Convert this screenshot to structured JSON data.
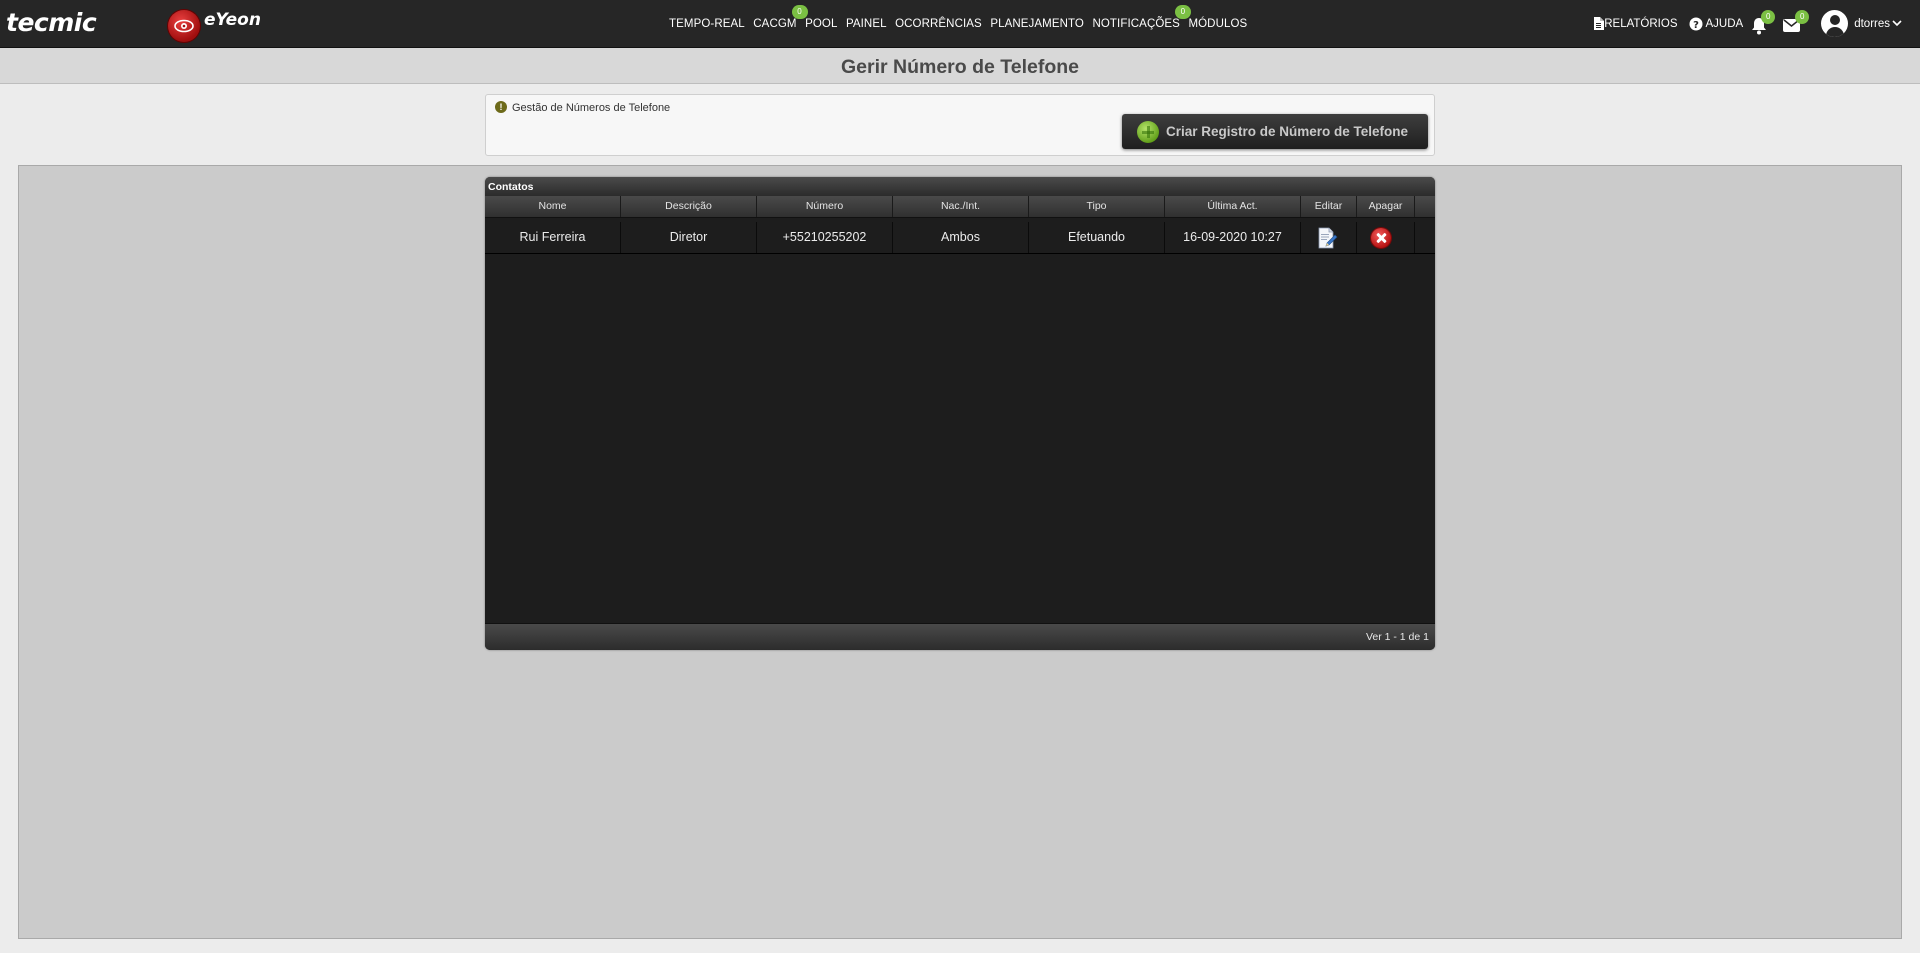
{
  "brand": {
    "tecmic": "tecmic",
    "eyeon": "eYeon"
  },
  "nav": [
    {
      "label": "TEMPO-REAL",
      "badge": null
    },
    {
      "label": "CACGM",
      "badge": "0"
    },
    {
      "label": "POOL",
      "badge": null
    },
    {
      "label": "PAINEL",
      "badge": null
    },
    {
      "label": "OCORRÊNCIAS",
      "badge": null
    },
    {
      "label": "PLANEJAMENTO",
      "badge": null
    },
    {
      "label": "NOTIFICAÇÕES",
      "badge": "0"
    },
    {
      "label": "MÓDULOS",
      "badge": null
    }
  ],
  "right_nav": {
    "reports": "RELATÓRIOS",
    "help": "AJUDA",
    "bell_badge": "0",
    "mail_badge": "0",
    "user": "dtorres"
  },
  "page": {
    "title": "Gerir Número de Telefone"
  },
  "info": {
    "text": "Gestão de Números de Telefone",
    "create_button": "Criar Registro de Número de Telefone"
  },
  "grid": {
    "caption": "Contatos",
    "columns": [
      "Nome",
      "Descrição",
      "Número",
      "Nac./Int.",
      "Tipo",
      "Última Act.",
      "Editar",
      "Apagar"
    ],
    "rows": [
      [
        "Rui Ferreira",
        "Diretor",
        "+55210255202",
        "Ambos",
        "Efetuando",
        "16-09-2020 10:27"
      ]
    ],
    "pager": "Ver 1 - 1 de 1"
  },
  "colors": {
    "accent_badge": "#7bc043",
    "topbar": "#262626",
    "grid_bg": "#1d1d1d"
  }
}
